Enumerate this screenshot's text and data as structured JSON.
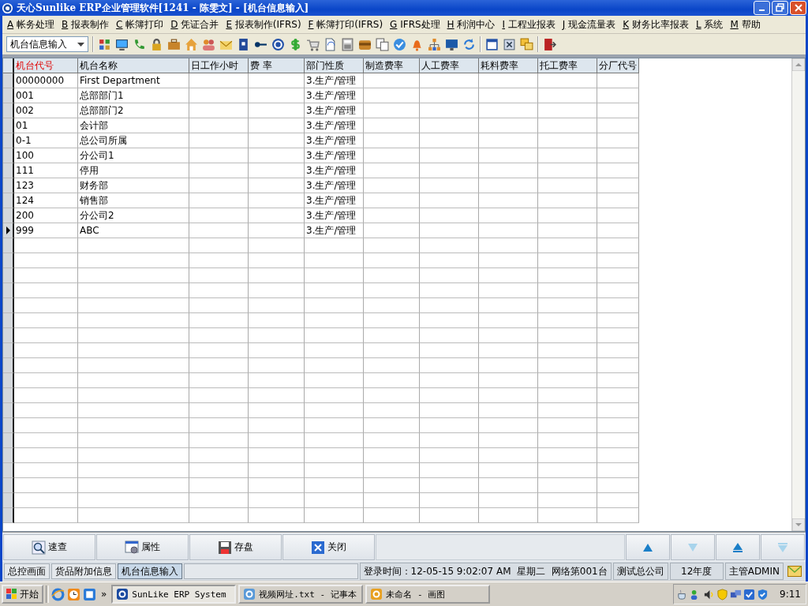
{
  "window": {
    "title": "天心Sunlike ERP企业管理软件[1241 - 陈雯文] - [机台信息输入]"
  },
  "menu": [
    {
      "key": "A",
      "label": "帐务处理"
    },
    {
      "key": "B",
      "label": "报表制作"
    },
    {
      "key": "C",
      "label": "帐簿打印"
    },
    {
      "key": "D",
      "label": "凭证合并"
    },
    {
      "key": "E",
      "label": "报表制作(IFRS)"
    },
    {
      "key": "F",
      "label": "帐簿打印(IFRS)"
    },
    {
      "key": "G",
      "label": "IFRS处理"
    },
    {
      "key": "H",
      "label": "利润中心"
    },
    {
      "key": "I",
      "label": "工程业报表"
    },
    {
      "key": "J",
      "label": "现金流量表"
    },
    {
      "key": "K",
      "label": "财务比率报表"
    },
    {
      "key": "L",
      "label": "系统"
    },
    {
      "key": "M",
      "label": "帮助"
    }
  ],
  "toolbar": {
    "dropdown": {
      "value": "机台信息输入"
    }
  },
  "table": {
    "columns": [
      {
        "label": "机台代号",
        "required": true
      },
      {
        "label": "机台名称",
        "required": false
      },
      {
        "label": "日工作小时",
        "required": false
      },
      {
        "label": "费  率",
        "required": false
      },
      {
        "label": "部门性质",
        "required": false
      },
      {
        "label": "制造费率",
        "required": false
      },
      {
        "label": "人工费率",
        "required": false
      },
      {
        "label": "耗料费率",
        "required": false
      },
      {
        "label": "托工费率",
        "required": false
      },
      {
        "label": "分厂代号",
        "required": false
      }
    ],
    "rows": [
      {
        "code": "00000000",
        "name": "First Department",
        "type": "3.生产/管理",
        "selected": false
      },
      {
        "code": "001",
        "name": "总部部门1",
        "type": "3.生产/管理",
        "selected": false
      },
      {
        "code": "002",
        "name": "总部部门2",
        "type": "3.生产/管理",
        "selected": false
      },
      {
        "code": "01",
        "name": "会计部",
        "type": "3.生产/管理",
        "selected": false
      },
      {
        "code": "0-1",
        "name": "总公司所属",
        "type": "3.生产/管理",
        "selected": false
      },
      {
        "code": "100",
        "name": "分公司1",
        "type": "3.生产/管理",
        "selected": false
      },
      {
        "code": "111",
        "name": "停用",
        "type": "3.生产/管理",
        "selected": false
      },
      {
        "code": "123",
        "name": "财务部",
        "type": "3.生产/管理",
        "selected": false
      },
      {
        "code": "124",
        "name": "销售部",
        "type": "3.生产/管理",
        "selected": false
      },
      {
        "code": "200",
        "name": "分公司2",
        "type": "3.生产/管理",
        "selected": false
      },
      {
        "code": "999",
        "name": "ABC",
        "type": "3.生产/管理",
        "selected": true
      }
    ]
  },
  "buttons": [
    {
      "kind": "search",
      "label": "速查"
    },
    {
      "kind": "properties",
      "label": "属性"
    },
    {
      "kind": "save",
      "label": "存盘"
    },
    {
      "kind": "close",
      "label": "关闭"
    }
  ],
  "nav_buttons": [
    {
      "kind": "up",
      "disabled": false
    },
    {
      "kind": "down",
      "disabled": true
    },
    {
      "kind": "top",
      "disabled": false
    },
    {
      "kind": "bottom",
      "disabled": true
    }
  ],
  "tabs": [
    {
      "label": "总控画面",
      "selected": false
    },
    {
      "label": "货品附加信息",
      "selected": false
    },
    {
      "label": "机台信息输入",
      "selected": true
    }
  ],
  "status_bar": {
    "login": "登录时间：12-05-15 9:02:07 AM  星期二  网络第001台",
    "company": "测试总公司",
    "year": "12年度",
    "user": "主管ADMIN"
  },
  "taskbar": {
    "start": "开始",
    "more": "»",
    "tasks": [
      {
        "label": "SunLike ERP System",
        "selected": true
      },
      {
        "label": "视频网址.txt - 记事本",
        "selected": false
      },
      {
        "label": "未命名 - 画图",
        "selected": false
      }
    ],
    "clock": "9:11"
  }
}
